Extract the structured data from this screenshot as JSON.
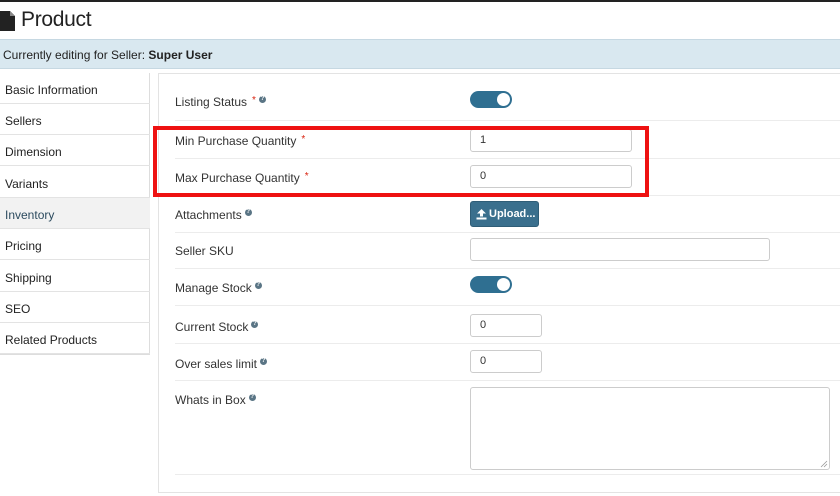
{
  "header": {
    "title": "Product",
    "icon": "document-icon"
  },
  "seller_bar": {
    "prefix": "Currently editing for Seller:",
    "seller_name": "Super User"
  },
  "sidebar": {
    "items": [
      {
        "label": "Basic Information"
      },
      {
        "label": "Sellers"
      },
      {
        "label": "Dimension"
      },
      {
        "label": "Variants"
      },
      {
        "label": "Inventory",
        "active": true
      },
      {
        "label": "Pricing"
      },
      {
        "label": "Shipping"
      },
      {
        "label": "SEO"
      },
      {
        "label": "Related Products"
      }
    ]
  },
  "form": {
    "listing_status": {
      "label": "Listing Status",
      "required": "*",
      "help": "?",
      "value": "on"
    },
    "min_purchase_quantity": {
      "label": "Min Purchase Quantity",
      "required": "*",
      "value": "1"
    },
    "max_purchase_quantity": {
      "label": "Max Purchase Quantity",
      "required": "*",
      "value": "0"
    },
    "attachments": {
      "label": "Attachments",
      "help": "?",
      "button_label": "Upload..."
    },
    "seller_sku": {
      "label": "Seller SKU",
      "value": ""
    },
    "manage_stock": {
      "label": "Manage Stock",
      "help": "?",
      "value": "on"
    },
    "current_stock": {
      "label": "Current Stock",
      "help": "?",
      "value": "0"
    },
    "over_sales_limit": {
      "label": "Over sales limit",
      "help": "?",
      "value": "0"
    },
    "whats_in_box": {
      "label": "Whats in Box",
      "help": "?",
      "value": ""
    }
  },
  "colors": {
    "toggle_on": "#2f6f91",
    "highlight_box": "#ee1111",
    "seller_bar": "#d9e8f0",
    "required": "#d9230f"
  }
}
